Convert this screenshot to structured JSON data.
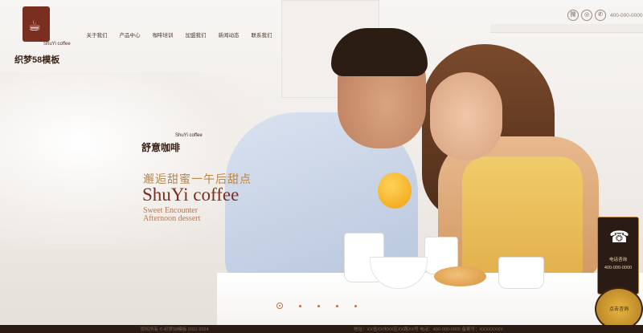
{
  "logo": {
    "mark": "☕",
    "sub": "ShuYi coffee",
    "name": "织梦58模板"
  },
  "nav": {
    "items": [
      "关于我们",
      "产品中心",
      "咖啡培训",
      "加盟我们",
      "新闻动态",
      "联系我们"
    ]
  },
  "top_icons": {
    "weibo": "微",
    "wechat": "◎",
    "phone_icon": "✆",
    "phone": "400-000-0000"
  },
  "hero": {
    "brand_cn": "舒意咖啡",
    "brand_en": "ShuYi coffee",
    "slogan_cn": "邂逅甜蜜一午后甜点",
    "slogan_main": "ShuYi coffee",
    "slogan_en_1": "Sweet Encounter",
    "slogan_en_2": "Afternoon dessert"
  },
  "slider": {
    "dots": 5,
    "active": 0
  },
  "side_widget": {
    "phone_icon": "☎",
    "label": "电话咨询",
    "phone": "400-000-0000",
    "button": "点击咨询"
  },
  "footer": {
    "left": "版权所有 © 织梦58模板 2011-2024",
    "right": "地址：XX省XX市XX区XX路XX号 电话：400-000-0000 备案号：XXXXXXXX"
  },
  "colors": {
    "brand": "#7a2e1f",
    "accent": "#b8874e",
    "footer_bg": "#2a1b14"
  }
}
